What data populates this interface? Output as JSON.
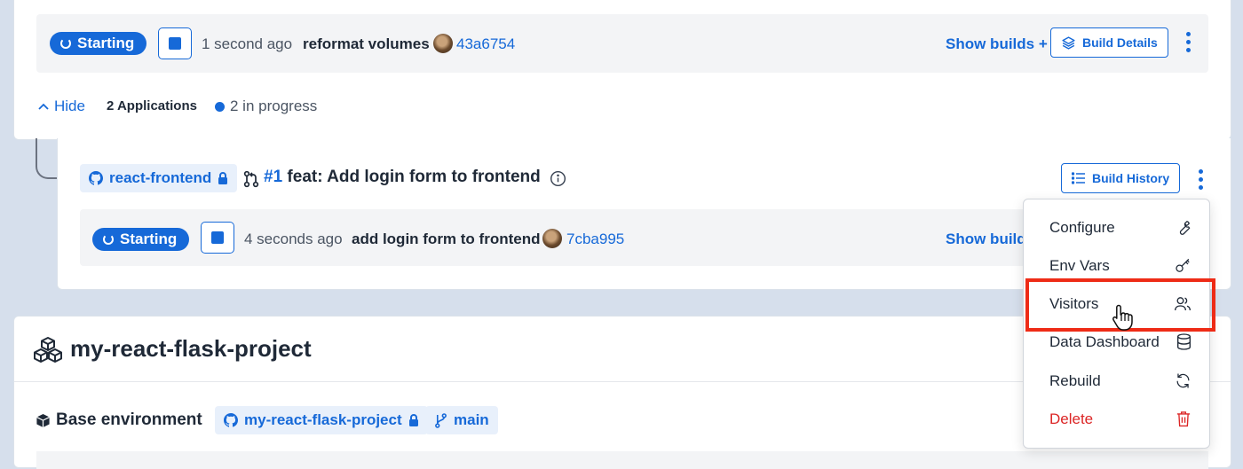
{
  "top_build": {
    "status": "Starting",
    "time": "1 second ago",
    "message": "reformat volumes",
    "commit": "43a6754",
    "show_builds": "Show builds +",
    "build_details": "Build Details"
  },
  "apps_bar": {
    "hide": "Hide",
    "applications": "2 Applications",
    "in_progress": "2 in progress"
  },
  "app": {
    "repo": "react-frontend",
    "pr_number": "#1",
    "pr_title": "feat: Add login form to frontend",
    "build_history": "Build History",
    "build": {
      "status": "Starting",
      "time": "4 seconds ago",
      "message": "add login form to frontend",
      "commit": "7cba995",
      "show_builds": "Show build"
    }
  },
  "project": {
    "title": "my-react-flask-project",
    "base_env": "Base environment",
    "repo": "my-react-flask-project",
    "branch": "main"
  },
  "menu": {
    "items": [
      {
        "label": "Configure",
        "icon": "wrench-icon"
      },
      {
        "label": "Env Vars",
        "icon": "key-icon"
      },
      {
        "label": "Visitors",
        "icon": "users-icon"
      },
      {
        "label": "Data Dashboard",
        "icon": "database-icon"
      },
      {
        "label": "Rebuild",
        "icon": "refresh-icon"
      },
      {
        "label": "Delete",
        "icon": "trash-icon"
      }
    ],
    "highlighted": "Visitors"
  },
  "colors": {
    "accent": "#1669d8",
    "danger": "#dc2626",
    "highlight": "#ee2b16",
    "background": "#d6dfec"
  }
}
